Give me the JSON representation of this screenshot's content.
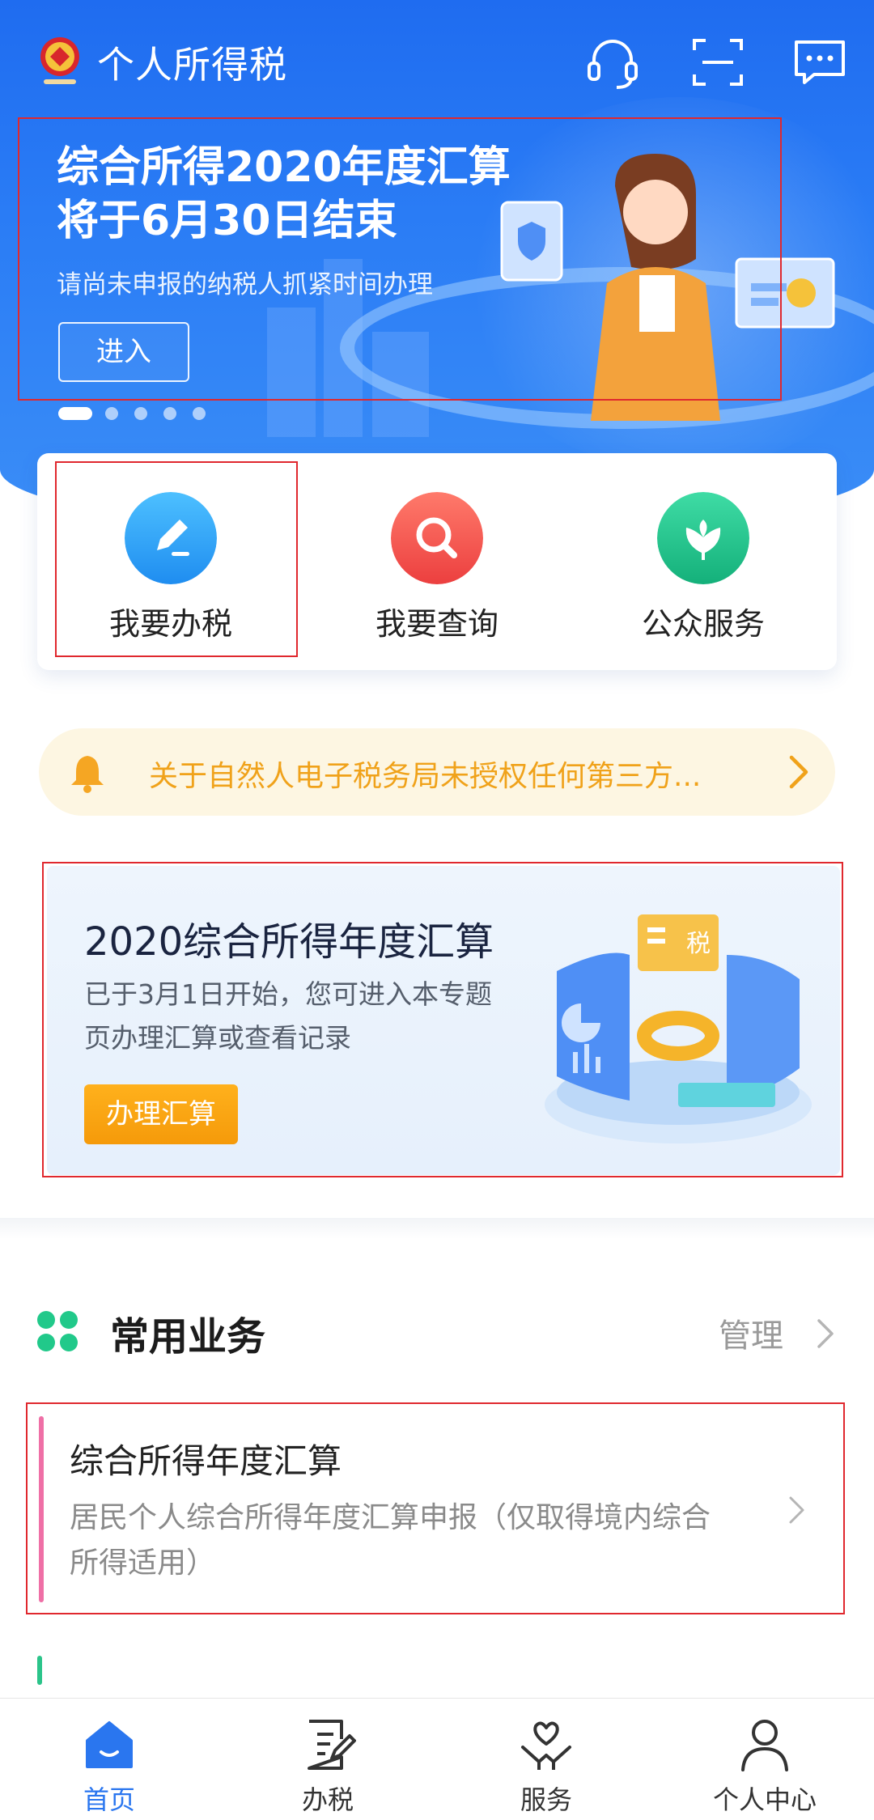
{
  "header": {
    "app_title": "个人所得税"
  },
  "banner": {
    "line1": "综合所得2020年度汇算",
    "line2": "将于6月30日结束",
    "subtitle": "请尚未申报的纳税人抓紧时间办理",
    "enter_button": "进入",
    "slides_total": 5,
    "active_slide": 1
  },
  "quick_actions": [
    {
      "label": "我要办税",
      "icon": "edit-icon",
      "color": "#2aa6f5"
    },
    {
      "label": "我要查询",
      "icon": "search-icon",
      "color": "#f2594f"
    },
    {
      "label": "公众服务",
      "icon": "flower-icon",
      "color": "#22c38b"
    }
  ],
  "notice": {
    "text": "关于自然人电子税务局未授权任何第三方..."
  },
  "promo": {
    "title": "2020综合所得年度汇算",
    "desc_line1": "已于3月1日开始，您可进入本专题",
    "desc_line2": "页办理汇算或查看记录",
    "button": "办理汇算",
    "art_label": "税"
  },
  "common_services": {
    "title": "常用业务",
    "manage_label": "管理",
    "items": [
      {
        "title": "综合所得年度汇算",
        "desc_line1": "居民个人综合所得年度汇算申报（仅取得境内综合",
        "desc_line2": "所得适用）"
      }
    ]
  },
  "tabbar": {
    "tabs": [
      {
        "label": "首页",
        "icon": "home-icon",
        "active": true
      },
      {
        "label": "办税",
        "icon": "document-edit-icon",
        "active": false
      },
      {
        "label": "服务",
        "icon": "heart-hand-icon",
        "active": false
      },
      {
        "label": "个人中心",
        "icon": "person-icon",
        "active": false
      }
    ]
  },
  "colors": {
    "brand_blue": "#2a76ef",
    "notice_orange": "#f0a21a",
    "promo_button": "#f59a0a",
    "highlight_box": "#e0282e"
  }
}
